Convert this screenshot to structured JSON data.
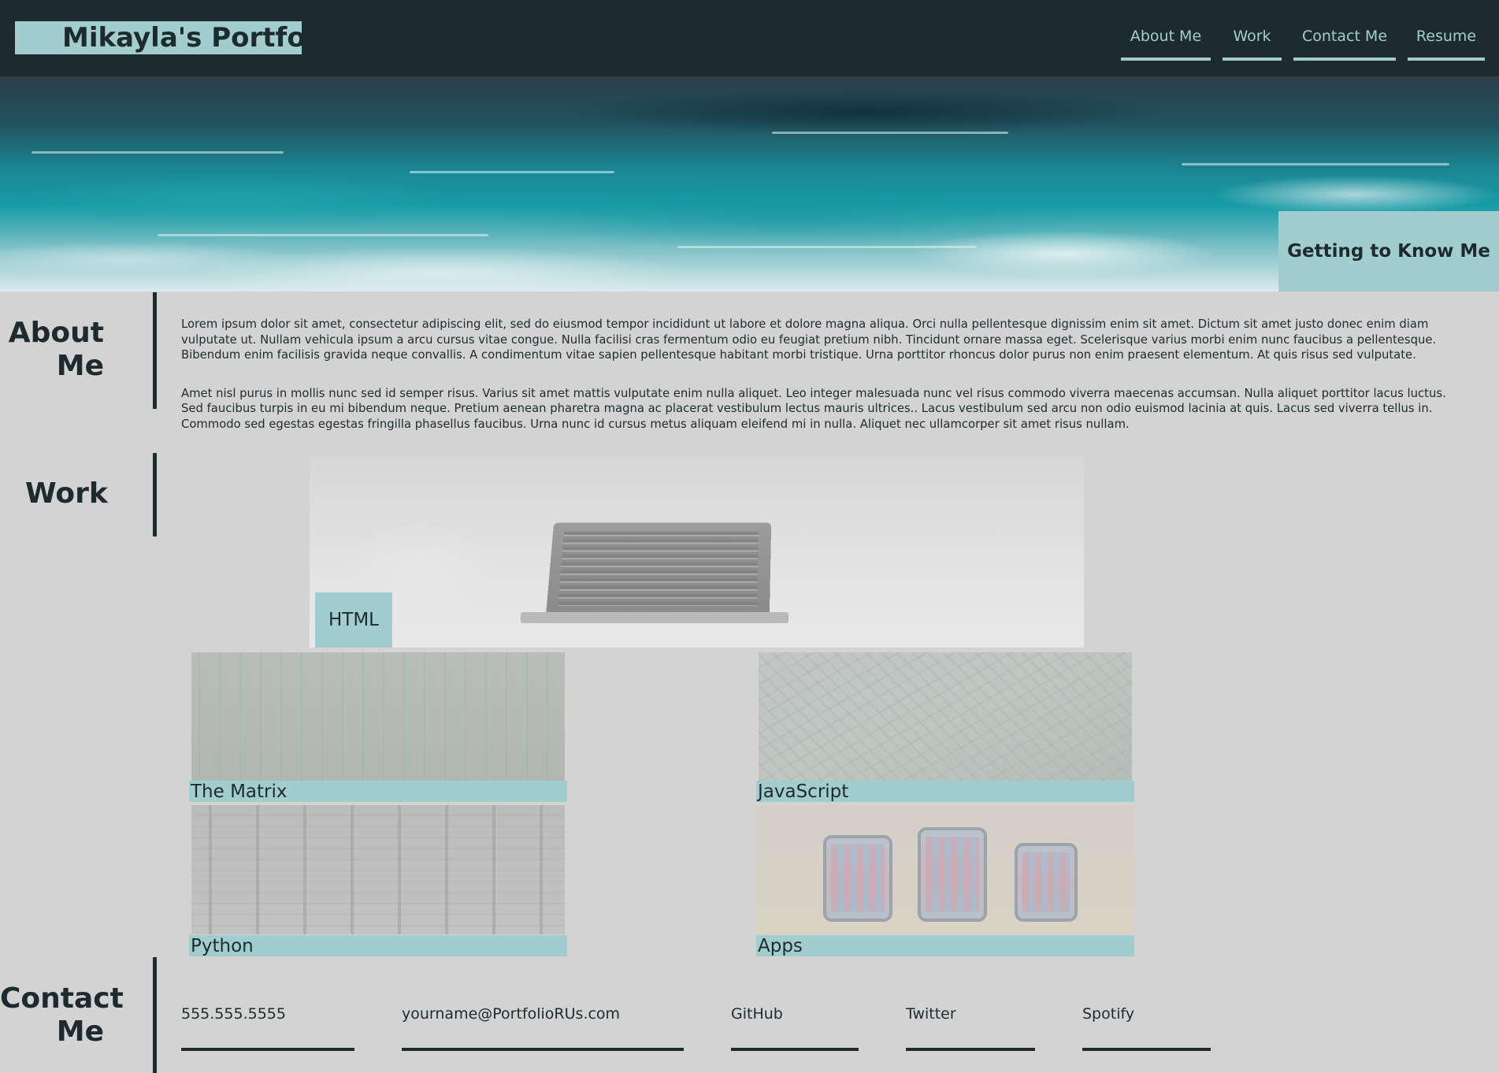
{
  "header": {
    "brand": "Mikayla's Portfolio",
    "nav": [
      {
        "label": "About Me"
      },
      {
        "label": "Work"
      },
      {
        "label": "Contact Me"
      },
      {
        "label": "Resume"
      }
    ]
  },
  "hero": {
    "badge": "Getting to Know Me"
  },
  "about": {
    "title_line1": "About",
    "title_line2": "Me",
    "paragraphs": [
      "Lorem ipsum dolor sit amet, consectetur adipiscing elit, sed do eiusmod tempor incididunt ut labore et dolore magna aliqua. Orci nulla pellentesque dignissim enim sit amet. Dictum sit amet justo donec enim diam vulputate ut. Nullam vehicula ipsum a arcu cursus vitae congue. Nulla facilisi cras fermentum odio eu feugiat pretium nibh. Tincidunt ornare massa eget. Scelerisque varius morbi enim nunc faucibus a pellentesque. Bibendum enim facilisis gravida neque convallis. A condimentum vitae sapien pellentesque habitant morbi tristique. Urna porttitor rhoncus dolor purus non enim praesent elementum. At quis risus sed vulputate.",
      "Amet nisl purus in mollis nunc sed id semper risus. Varius sit amet mattis vulputate enim nulla aliquet. Leo integer malesuada nunc vel risus commodo viverra maecenas accumsan. Nulla aliquet porttitor lacus luctus. Sed faucibus turpis in eu mi bibendum neque. Pretium aenean pharetra magna ac placerat vestibulum lectus mauris ultrices.. Lacus vestibulum sed arcu non odio euismod lacinia at quis. Lacus sed viverra tellus in. Commodo sed egestas egestas fringilla phasellus faucibus. Urna nunc id cursus metus aliquam eleifend mi in nulla. Aliquet nec ullamcorper sit amet risus nullam."
    ]
  },
  "work": {
    "title": "Work",
    "projects": [
      {
        "label": "HTML"
      },
      {
        "label": "The Matrix"
      },
      {
        "label": "JavaScript"
      },
      {
        "label": "Python"
      },
      {
        "label": "Apps"
      }
    ]
  },
  "contact": {
    "title_line1": "Contact",
    "title_line2": "Me",
    "items": [
      {
        "label": "555.555.5555"
      },
      {
        "label": "yourname@PortfolioRUs.com"
      },
      {
        "label": "GitHub"
      },
      {
        "label": "Twitter"
      },
      {
        "label": "Spotify"
      }
    ]
  },
  "colors": {
    "dark": "#1d2b2e",
    "accent": "#a2cdcf",
    "page_bg": "#d3d3d3"
  }
}
